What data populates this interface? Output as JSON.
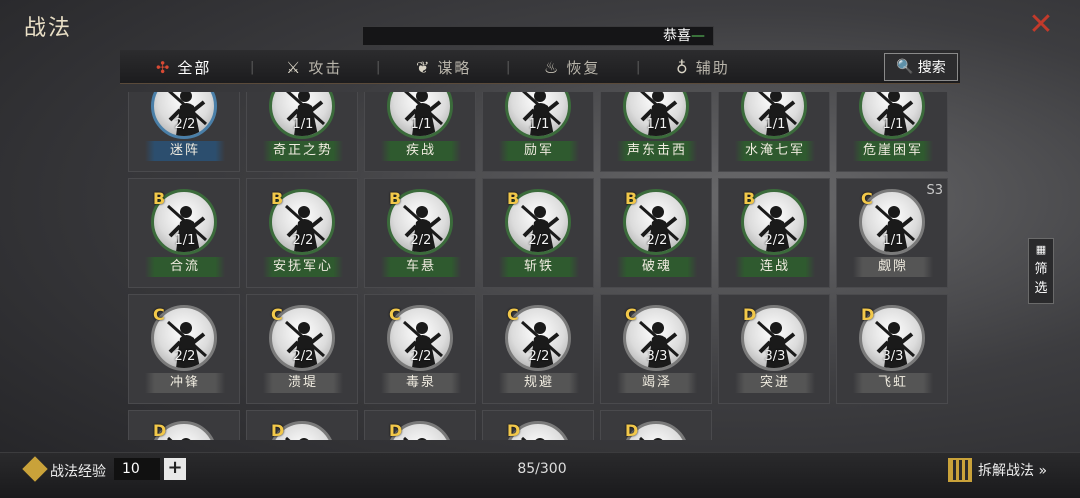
{
  "window": {
    "title": "战法",
    "close_icon": "close-icon"
  },
  "marquee": {
    "text": "恭喜",
    "dash": "—"
  },
  "tabs": [
    {
      "label": "全部",
      "icon": "all-icon",
      "glyph": "✣",
      "active": true
    },
    {
      "label": "攻击",
      "icon": "crossed-swords-icon",
      "glyph": "⚔",
      "active": false
    },
    {
      "label": "谋略",
      "icon": "fan-icon",
      "glyph": "❦",
      "active": false
    },
    {
      "label": "恢复",
      "icon": "pot-icon",
      "glyph": "♨",
      "active": false
    },
    {
      "label": "辅助",
      "icon": "pouch-icon",
      "glyph": "♁",
      "active": false
    }
  ],
  "search": {
    "label": "搜索",
    "icon": "search-icon"
  },
  "filter": {
    "label": "筛选",
    "icon": "grid-icon"
  },
  "tactics": [
    {
      "name": "迷阵",
      "grade": "",
      "count": "2/2",
      "color": "blue"
    },
    {
      "name": "奇正之势",
      "grade": "",
      "count": "1/1",
      "color": "green"
    },
    {
      "name": "疾战",
      "grade": "",
      "count": "1/1",
      "color": "green"
    },
    {
      "name": "励军",
      "grade": "",
      "count": "1/1",
      "color": "green"
    },
    {
      "name": "声东击西",
      "grade": "",
      "count": "1/1",
      "color": "green"
    },
    {
      "name": "水淹七军",
      "grade": "",
      "count": "1/1",
      "color": "green"
    },
    {
      "name": "危崖困军",
      "grade": "",
      "count": "1/1",
      "color": "green"
    },
    {
      "name": "合流",
      "grade": "B",
      "count": "1/1",
      "color": "green"
    },
    {
      "name": "安抚军心",
      "grade": "B",
      "count": "2/2",
      "color": "green"
    },
    {
      "name": "车悬",
      "grade": "B",
      "count": "2/2",
      "color": "green"
    },
    {
      "name": "斩铁",
      "grade": "B",
      "count": "2/2",
      "color": "green"
    },
    {
      "name": "破魂",
      "grade": "B",
      "count": "2/2",
      "color": "green"
    },
    {
      "name": "连战",
      "grade": "B",
      "count": "2/2",
      "color": "green"
    },
    {
      "name": "觑隙",
      "grade": "C",
      "count": "1/1",
      "color": "grey",
      "season": "S3"
    },
    {
      "name": "冲锋",
      "grade": "C",
      "count": "2/2",
      "color": "grey"
    },
    {
      "name": "溃堤",
      "grade": "C",
      "count": "2/2",
      "color": "grey"
    },
    {
      "name": "毒泉",
      "grade": "C",
      "count": "2/2",
      "color": "grey"
    },
    {
      "name": "规避",
      "grade": "C",
      "count": "2/2",
      "color": "grey"
    },
    {
      "name": "竭泽",
      "grade": "C",
      "count": "3/3",
      "color": "grey"
    },
    {
      "name": "突进",
      "grade": "D",
      "count": "3/3",
      "color": "grey"
    },
    {
      "name": "飞虹",
      "grade": "D",
      "count": "3/3",
      "color": "grey"
    },
    {
      "name": "",
      "grade": "D",
      "count": "",
      "color": "grey"
    },
    {
      "name": "",
      "grade": "D",
      "count": "",
      "color": "grey"
    },
    {
      "name": "",
      "grade": "D",
      "count": "",
      "color": "grey"
    },
    {
      "name": "",
      "grade": "D",
      "count": "",
      "color": "grey"
    },
    {
      "name": "",
      "grade": "D",
      "count": "",
      "color": "grey"
    }
  ],
  "bottom": {
    "exp_label": "战法经验",
    "exp_value": "10",
    "plus": "+",
    "capacity": "85/300",
    "decompose_label": "拆解战法 »"
  }
}
